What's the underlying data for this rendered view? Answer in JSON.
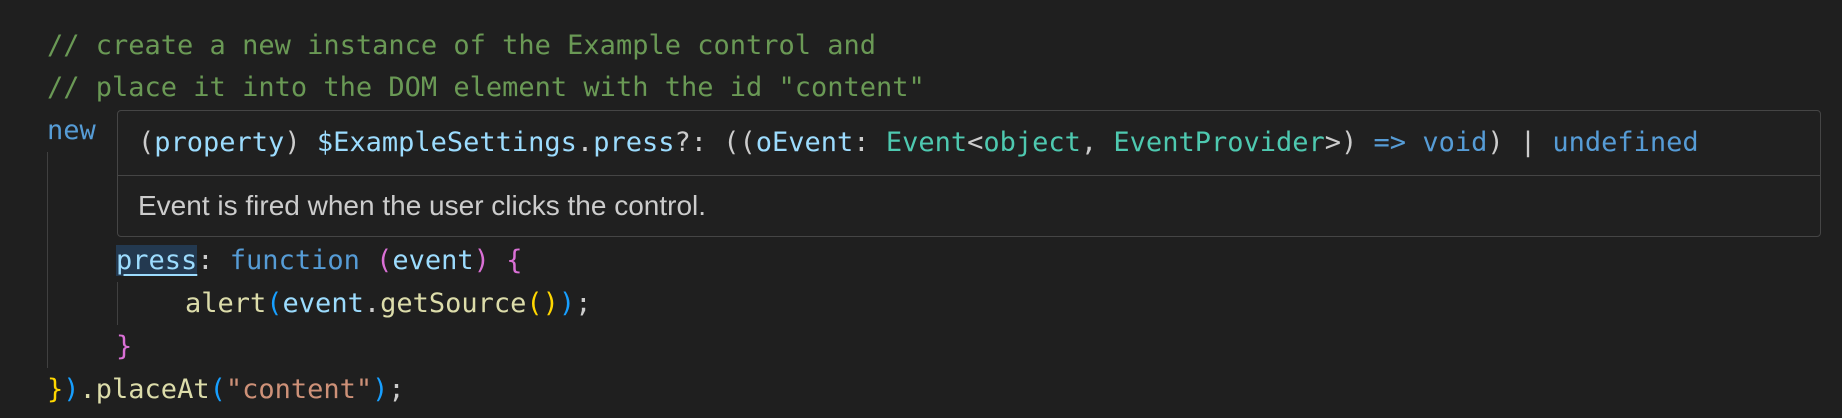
{
  "editor": {
    "lines": {
      "comment1": "// create a new instance of the Example control and",
      "comment2": "// place it into the DOM element with the id \"content\"",
      "new_kw": "new",
      "press_key": "press",
      "colon": ": ",
      "function_kw": "function",
      "space": " ",
      "paren_open": "(",
      "event_param": "event",
      "paren_close": ")",
      "brace_open": "{",
      "alert_fn": "alert",
      "event_obj": "event",
      "dot": ".",
      "getsource_fn": "getSource",
      "call_parens": "()",
      "semicolon": ";",
      "brace_close": "}",
      "final_brace": "}",
      "final_paren": ")",
      "placeat_fn": ".placeAt",
      "content_str": "\"content\"",
      "final_end": ");"
    }
  },
  "hover": {
    "signature": {
      "open": "(",
      "property_kw": "property",
      "close_space": ") ",
      "settings_name": "$ExampleSettings",
      "dot": ".",
      "member": "press",
      "optional": "?: ((",
      "param": "oEvent",
      "colon": ": ",
      "event_type": "Event",
      "lt": "<",
      "object_type": "object",
      "comma": ", ",
      "provider_type": "EventProvider",
      "gt_close": ">) ",
      "arrow": "=>",
      "space": " ",
      "void_kw": "void",
      "pipe": ") | ",
      "undefined_kw": "undefined"
    },
    "documentation": "Event is fired when the user clicks the control."
  },
  "colors": {
    "background": "#1f1f1f",
    "comment": "#6a9955",
    "keyword": "#569cd6",
    "variable": "#9cdcfe",
    "function": "#dcdcaa",
    "string": "#ce9178",
    "type": "#4ec9b0"
  }
}
